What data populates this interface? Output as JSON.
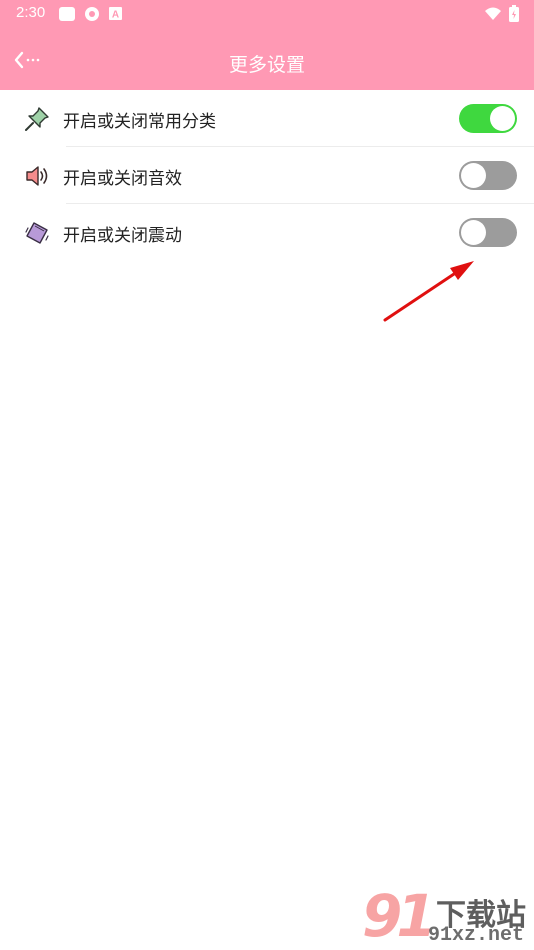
{
  "status_bar": {
    "time": "2:30"
  },
  "app_bar": {
    "title": "更多设置"
  },
  "settings": [
    {
      "label": "开启或关闭常用分类",
      "enabled": true,
      "icon": "pin-icon"
    },
    {
      "label": "开启或关闭音效",
      "enabled": false,
      "icon": "speaker-icon"
    },
    {
      "label": "开启或关闭震动",
      "enabled": false,
      "icon": "phone-vibrate-icon"
    }
  ],
  "watermark": {
    "number": "91",
    "brand": "下载站",
    "domain": "91xz.net"
  },
  "colors": {
    "header": "#ff99b4",
    "switch_on": "#3fd83f",
    "switch_off": "#9c9c9c",
    "annotation_arrow": "#e01010"
  }
}
